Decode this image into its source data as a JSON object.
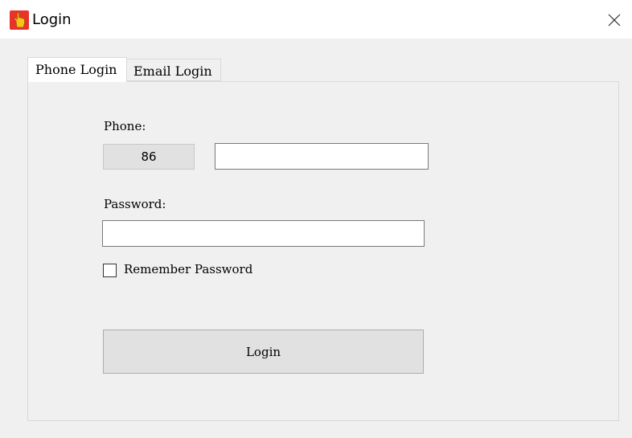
{
  "window": {
    "title": "Login",
    "app_icon": "hand-pointer-icon",
    "close_icon": "close-icon"
  },
  "tabs": [
    {
      "label": "Phone Login",
      "selected": true
    },
    {
      "label": "Email Login",
      "selected": false
    }
  ],
  "form": {
    "phone_label": "Phone:",
    "country_code": "86",
    "phone_value": "",
    "password_label": "Password:",
    "password_value": "",
    "remember_label": "Remember Password",
    "remember_checked": false,
    "login_button": "Login"
  },
  "colors": {
    "client_background": "#f0f0f0",
    "button_background": "#e1e1e1",
    "icon_red": "#e8332b",
    "icon_yellow": "#f7c21a"
  }
}
